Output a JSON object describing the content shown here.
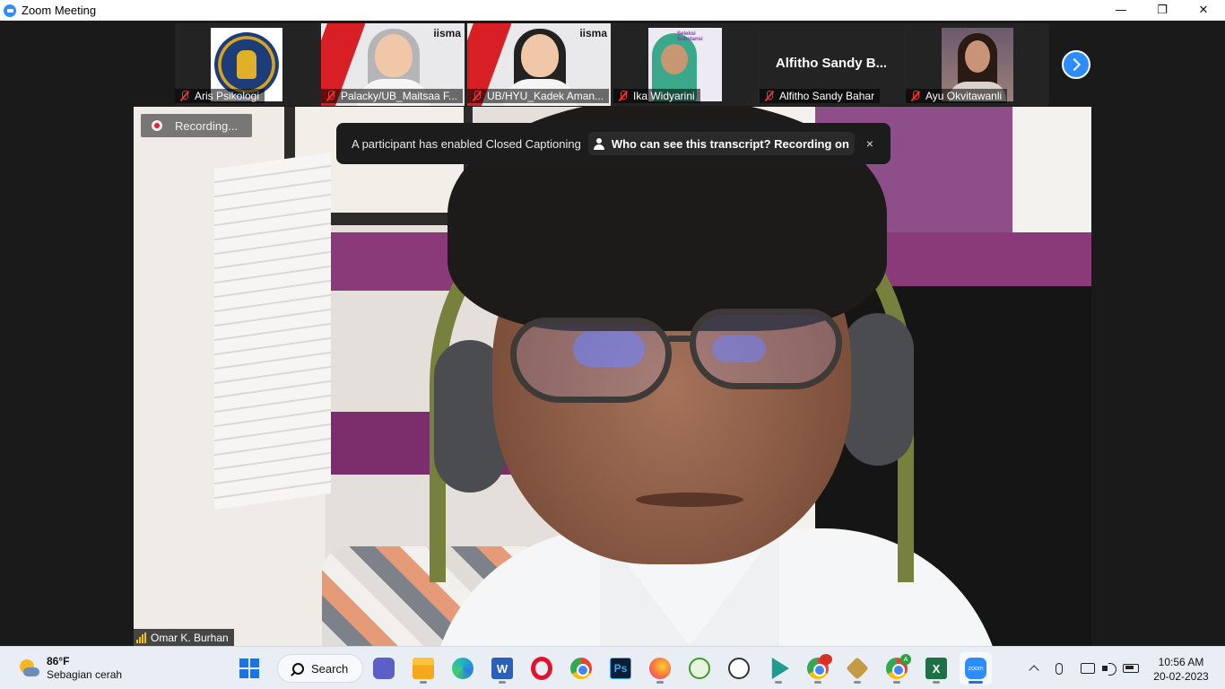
{
  "window": {
    "title": "Zoom Meeting",
    "controls": {
      "minimize": "—",
      "maximize": "❐",
      "close": "✕"
    }
  },
  "participants": [
    {
      "name": "Aris Psikologi",
      "muted": true,
      "tile": "logo"
    },
    {
      "name": "Palacky/UB_Maitsaa F...",
      "muted": true,
      "tile": "iisma",
      "brand": "iisma"
    },
    {
      "name": "UB/HYU_Kadek Aman...",
      "muted": true,
      "tile": "iisma",
      "brand": "iisma"
    },
    {
      "name": "Ika Widyarini",
      "muted": true,
      "tile": "photo",
      "overlay_text": "Seleksi Substansi"
    },
    {
      "name": "Alfitho Sandy Bahar",
      "muted": true,
      "tile": "name",
      "display_name": "Alfitho Sandy B..."
    },
    {
      "name": "Ayu Okvitawanli",
      "muted": true,
      "tile": "photo"
    }
  ],
  "main_video": {
    "speaker": "Omar K. Burhan",
    "recording_label": "Recording...",
    "caption_banner": {
      "message": "A participant has enabled Closed Captioning",
      "link": "Who can see this transcript? Recording on",
      "close": "×"
    }
  },
  "taskbar": {
    "weather": {
      "temp": "86°F",
      "condition": "Sebagian cerah"
    },
    "search_label": "Search",
    "word_letter": "W",
    "ps_letters": "Ps",
    "excel_letter": "X",
    "zoom_label": "zoom",
    "badge_a": "A",
    "clock": {
      "time": "10:56 AM",
      "date": "20-02-2023"
    }
  },
  "colors": {
    "zoom_blue": "#2d8cff",
    "muted_red": "#e33333",
    "recording_red": "#e02828"
  }
}
